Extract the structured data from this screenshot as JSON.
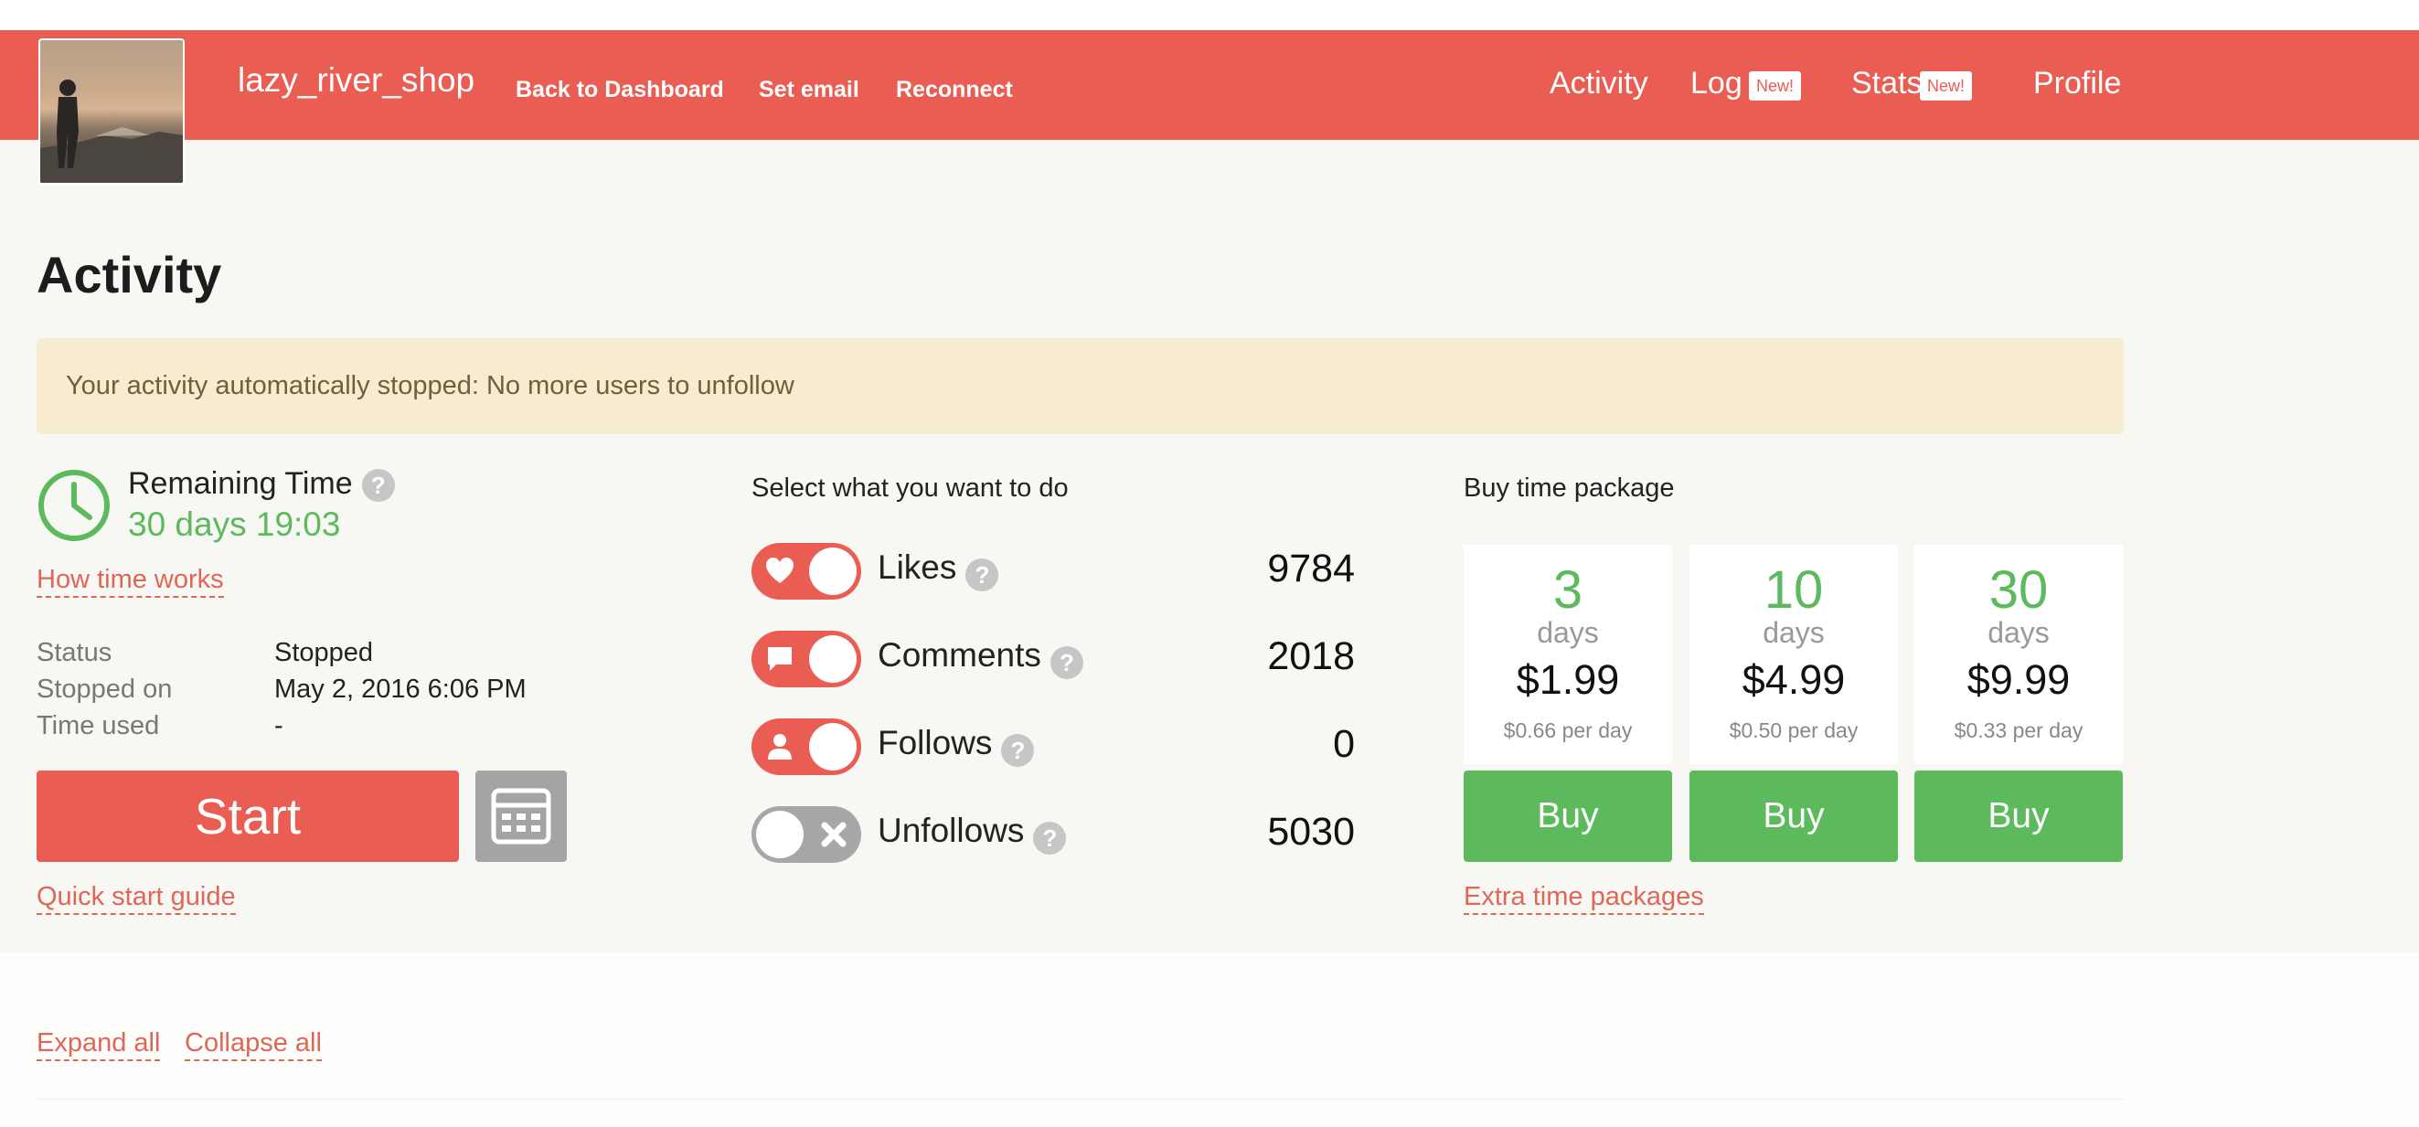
{
  "header": {
    "username": "lazy_river_shop",
    "links": [
      "Back to Dashboard",
      "Set email",
      "Reconnect"
    ],
    "tabs": [
      {
        "label": "Activity",
        "badge": ""
      },
      {
        "label": "Log",
        "badge": "New!"
      },
      {
        "label": "Stats",
        "badge": "New!"
      },
      {
        "label": "Profile",
        "badge": ""
      }
    ],
    "accent_color": "#e95d52"
  },
  "page": {
    "title": "Activity",
    "alert": "Your activity automatically stopped: No more users to unfollow"
  },
  "time": {
    "remaining_label": "Remaining Time",
    "remaining_value": "30 days 19:03",
    "how_link": "How time works",
    "status_rows": [
      {
        "label": "Status",
        "value": "Stopped"
      },
      {
        "label": "Stopped on",
        "value": "May 2, 2016 6:06 PM"
      },
      {
        "label": "Time used",
        "value": "-"
      }
    ],
    "start_label": "Start",
    "calendar_icon": "calendar-icon",
    "guide_link": "Quick start guide"
  },
  "actions": {
    "heading": "Select what you want to do",
    "items": [
      {
        "label": "Likes",
        "count": "9784",
        "enabled": true,
        "icon": "heart-icon"
      },
      {
        "label": "Comments",
        "count": "2018",
        "enabled": true,
        "icon": "comment-icon"
      },
      {
        "label": "Follows",
        "count": "0",
        "enabled": true,
        "icon": "user-icon"
      },
      {
        "label": "Unfollows",
        "count": "5030",
        "enabled": false,
        "icon": "close-icon"
      }
    ]
  },
  "packages": {
    "heading": "Buy time package",
    "items": [
      {
        "days": "3",
        "unit": "days",
        "price": "$1.99",
        "per_day": "$0.66 per day",
        "button": "Buy"
      },
      {
        "days": "10",
        "unit": "days",
        "price": "$4.99",
        "per_day": "$0.50 per day",
        "button": "Buy"
      },
      {
        "days": "30",
        "unit": "days",
        "price": "$9.99",
        "per_day": "$0.33 per day",
        "button": "Buy"
      }
    ],
    "extra_link": "Extra time packages"
  },
  "bottom": {
    "expand": "Expand all",
    "collapse": "Collapse all"
  },
  "help_glyph": "?"
}
